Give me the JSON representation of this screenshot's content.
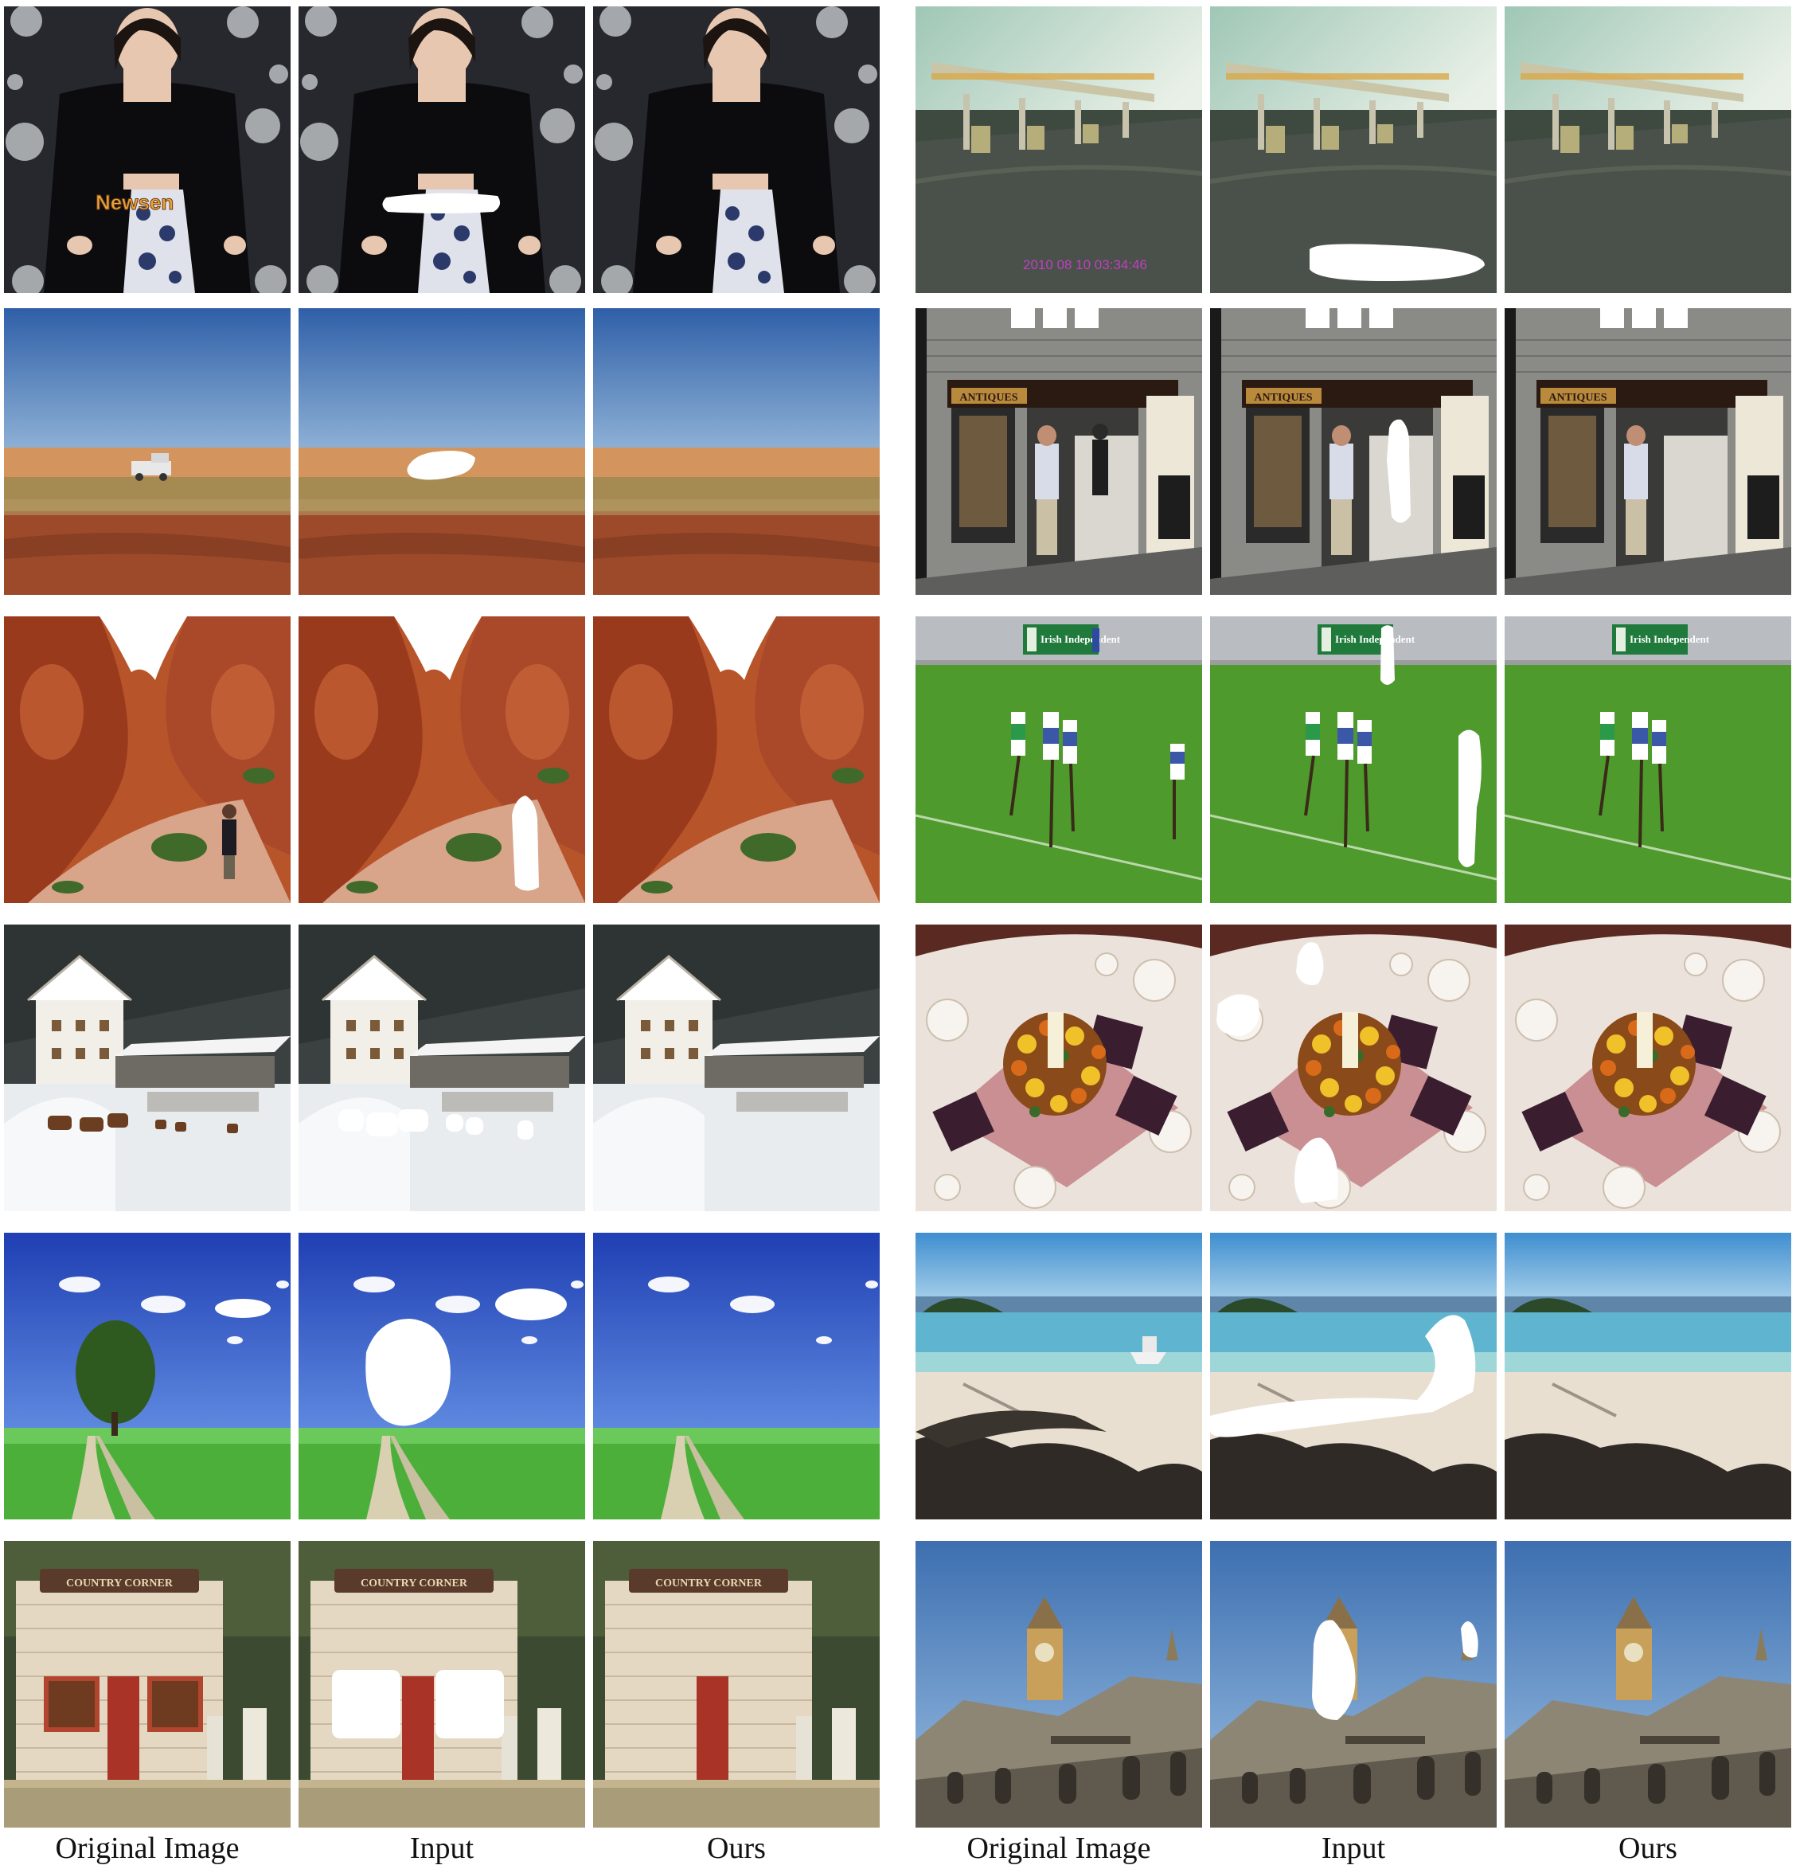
{
  "overlay_text": {
    "newsen_logo": "Newsen",
    "timestamp": "2010 08 10 03:34:46",
    "antiques_sign": "ANTIQUES",
    "irish_independent_banner": "Irish Independent",
    "country_corner_sign": "COUNTRY CORNER"
  },
  "column_labels": {
    "left": [
      "Original Image",
      "Input",
      "Ours"
    ],
    "right": [
      "Original Image",
      "Input",
      "Ours"
    ]
  },
  "colors": {
    "mask": "#ffffff",
    "timestamp": "#c040c0"
  }
}
